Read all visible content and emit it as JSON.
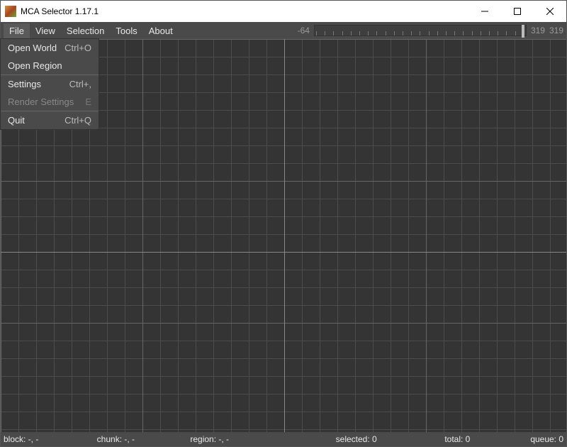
{
  "window": {
    "title": "MCA Selector 1.17.1"
  },
  "menubar": {
    "items": [
      "File",
      "View",
      "Selection",
      "Tools",
      "About"
    ],
    "slider_min_label": "-64",
    "slider_max_label_a": "319",
    "slider_max_label_b": "319"
  },
  "file_menu": {
    "open_world": {
      "label": "Open World",
      "shortcut": "Ctrl+O"
    },
    "open_region": {
      "label": "Open Region",
      "shortcut": ""
    },
    "settings": {
      "label": "Settings",
      "shortcut": "Ctrl+,"
    },
    "render_settings": {
      "label": "Render Settings",
      "shortcut": "E"
    },
    "quit": {
      "label": "Quit",
      "shortcut": "Ctrl+Q"
    }
  },
  "status": {
    "block": "block: -, -",
    "chunk": "chunk: -, -",
    "region": "region: -, -",
    "selected": "selected: 0",
    "total": "total: 0",
    "queue": "queue: 0"
  }
}
